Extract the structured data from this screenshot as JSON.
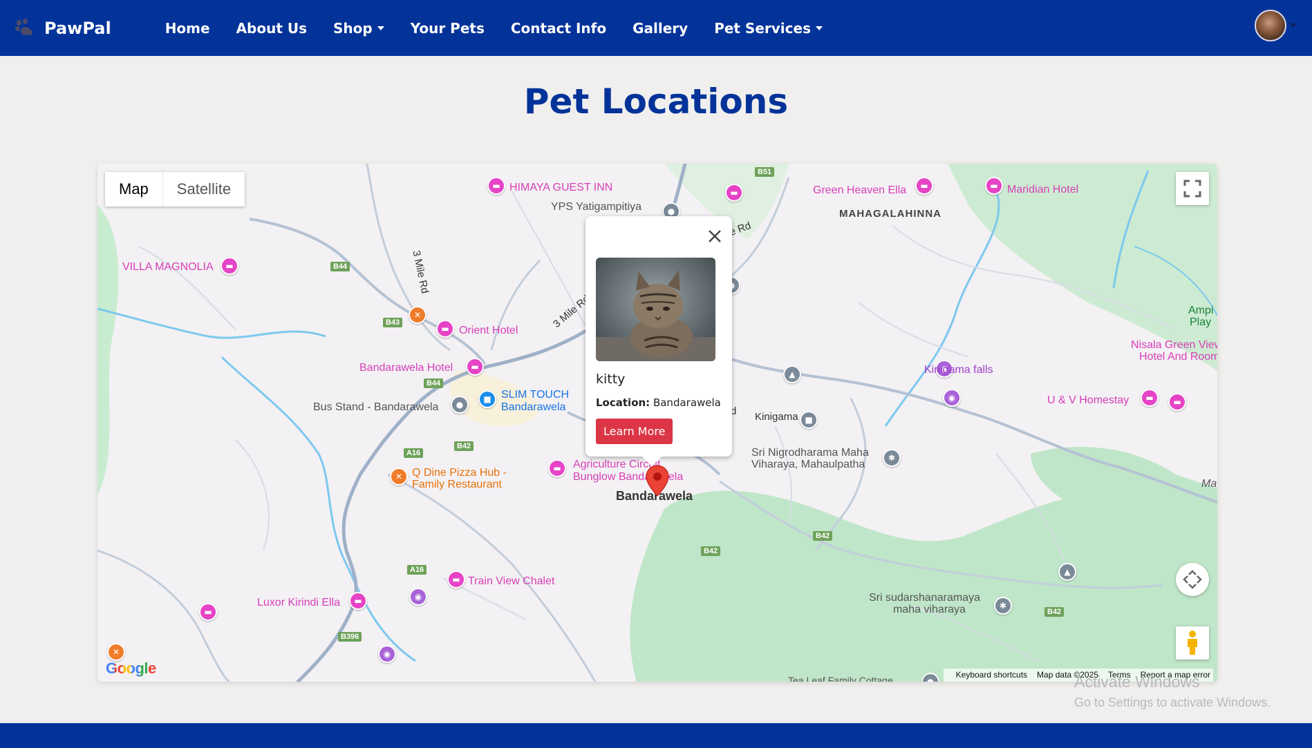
{
  "navbar": {
    "brand": "PawPal",
    "links": [
      {
        "label": "Home"
      },
      {
        "label": "About Us"
      },
      {
        "label": "Shop",
        "dropdown": true
      },
      {
        "label": "Your Pets"
      },
      {
        "label": "Contact Info"
      },
      {
        "label": "Gallery"
      },
      {
        "label": "Pet Services",
        "dropdown": true
      }
    ]
  },
  "page": {
    "title": "Pet Locations"
  },
  "map": {
    "type_control": {
      "map_label": "Map",
      "satellite_label": "Satellite",
      "selected": "Map"
    },
    "labels": {
      "himaya": "HIMAYA GUEST INN",
      "yps": "YPS Yatigampitiya",
      "green_heaven": "Green Heaven Ella",
      "maridian": "Maridian Hotel",
      "mahagalahinna": "MAHAGALAHINNA",
      "villa_magnolia": "VILLA MAGNOLIA",
      "mile_rd_1": "3 Mile Rd",
      "mile_rd_2": "3 Mile Rd",
      "orient_hotel": "Orient Hotel",
      "bandarawela_hotel": "Bandarawela Hotel",
      "slim_touch_1": "SLIM TOUCH",
      "slim_touch_2": "Bandarawela",
      "bus_stand": "Bus Stand - Bandarawela",
      "q_dine_1": "Q Dine Pizza Hub -",
      "q_dine_2": "Family Restaurant",
      "agri_1": "Agriculture Circuit",
      "agri_2": "Bunglow Bandarawela",
      "bandarawela": "Bandarawela",
      "kinigama": "Kinigama",
      "kinigama_falls": "Kinigama falls",
      "nigrodharama_1": "Sri Nigrodharama Maha",
      "nigrodharama_2": "Viharaya, Mahaulpatha",
      "uv_homestay": "U & V Homestay",
      "nisala_1": "Nisala Green View",
      "nisala_2": "Hotel And Room",
      "ampi_1": "Ampi",
      "ampi_2": "Play",
      "ma": "Ma",
      "train_view": "Train View Chalet",
      "luxor": "Luxor Kirindi Ella",
      "sudarshana_1": "Sri sudarshanaramaya",
      "sudarshana_2": "maha viharaya",
      "tea_leaf": "Tea Leaf Family Cottage",
      "rd_fragment": "e Rd",
      "d_fragment": "d"
    },
    "road_shields": [
      "B51",
      "B44",
      "B43",
      "B44",
      "B42",
      "A16",
      "A16",
      "B396",
      "B42",
      "B42",
      "B42"
    ],
    "google": "Google",
    "attribution": {
      "shortcuts": "Keyboard shortcuts",
      "data": "Map data ©2025",
      "terms": "Terms",
      "report": "Report a map error"
    },
    "info_window": {
      "pet_name": "kitty",
      "location_label": "Location:",
      "location_value": "Bandarawela",
      "button_label": "Learn More"
    }
  },
  "watermark": {
    "line1": "Activate Windows",
    "line2": "Go to Settings to activate Windows."
  },
  "colors": {
    "brand": "#033399",
    "danger": "#dc3545",
    "background": "#f0efee"
  },
  "icons": [
    "paw-icon",
    "caret-down-icon",
    "fullscreen-icon",
    "camera-control-icon",
    "pegman-icon",
    "close-icon",
    "map-marker-icon"
  ]
}
